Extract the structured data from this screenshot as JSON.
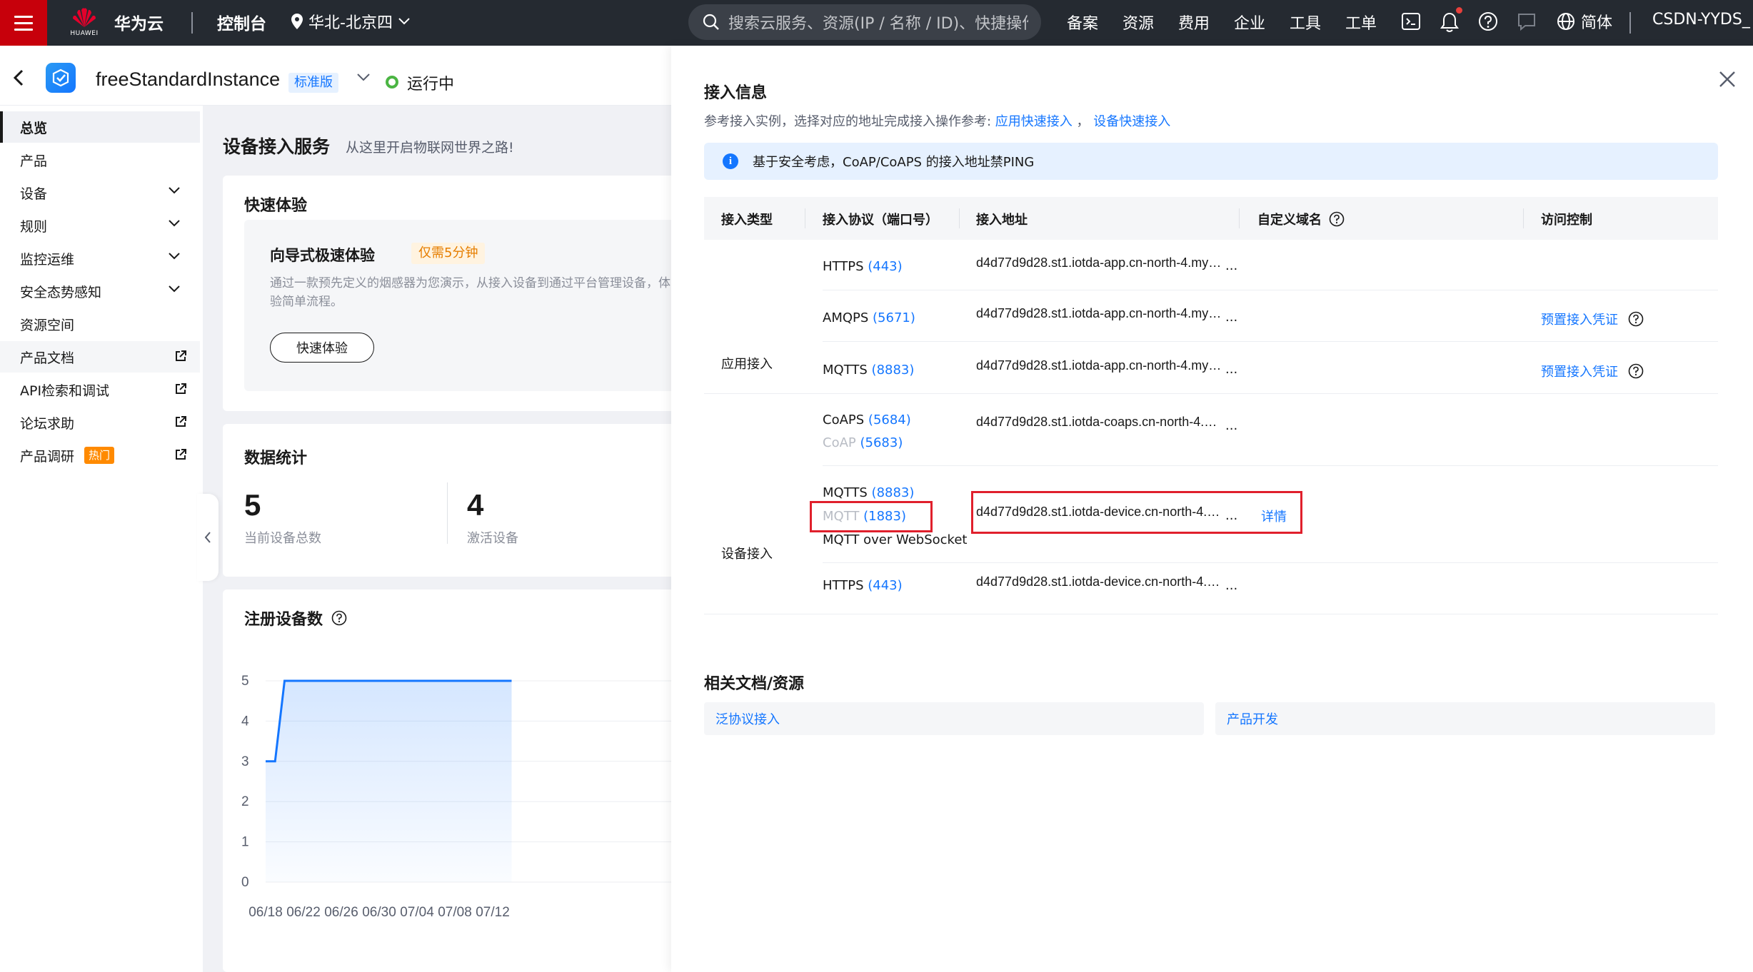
{
  "topnav": {
    "brand_word": "HUAWEI",
    "brand_name": "华为云",
    "console": "控制台",
    "region": "华北-北京四",
    "search_placeholder": "搜索云服务、资源(IP / 名称 / ID)、快捷操作…",
    "links": [
      "备案",
      "资源",
      "费用",
      "企业",
      "工具",
      "工单"
    ],
    "language": "简体",
    "account": "CSDN-YYDS_"
  },
  "instance": {
    "name": "freeStandardInstance",
    "edition": "标准版",
    "status": "运行中"
  },
  "sidebar": {
    "items": [
      {
        "label": "总览",
        "active": true
      },
      {
        "label": "产品"
      },
      {
        "label": "设备",
        "expandable": true
      },
      {
        "label": "规则",
        "expandable": true
      },
      {
        "label": "监控运维",
        "expandable": true
      },
      {
        "label": "安全态势感知",
        "expandable": true
      },
      {
        "label": "资源空间"
      },
      {
        "label": "产品文档",
        "external": true
      },
      {
        "label": "API检索和调试",
        "external": true
      },
      {
        "label": "论坛求助",
        "external": true
      },
      {
        "label": "产品调研",
        "external": true,
        "badge": "热门"
      }
    ]
  },
  "main": {
    "title": "设备接入服务",
    "subtitle": "从这里开启物联网世界之路!",
    "quick": {
      "title": "快速体验",
      "heading": "向导式极速体验",
      "badge": "仅需5分钟",
      "desc": "通过一款预先定义的烟感器为您演示，从接入设备到通过平台管理设备，体验简单流程。",
      "button": "快速体验"
    },
    "stats": {
      "title": "数据统计",
      "total_devices": "5",
      "total_label": "当前设备总数",
      "active_devices": "4",
      "active_label": "激活设备"
    },
    "chart_title": "注册设备数"
  },
  "chart_data": {
    "type": "area",
    "title": "注册设备数",
    "x": [
      "06/18",
      "06/22",
      "06/26",
      "06/30",
      "07/04",
      "07/08",
      "07/12"
    ],
    "points": [
      {
        "x": "06/18",
        "y": 3
      },
      {
        "x": "06/19",
        "y": 3
      },
      {
        "x": "06/20",
        "y": 5
      },
      {
        "x": "07/14",
        "y": 5
      }
    ],
    "yticks": [
      0,
      1,
      2,
      3,
      4,
      5
    ],
    "ylim": [
      0,
      5
    ],
    "color": "#1476ff"
  },
  "drawer": {
    "title": "接入信息",
    "desc_prefix": "参考接入实例，选择对应的地址完成接入操作参考:",
    "desc_link1": "应用快速接入",
    "desc_sep": "，",
    "desc_link2": "设备快速接入",
    "alert": "基于安全考虑，CoAP/CoAPS 的接入地址禁PING",
    "columns": [
      "接入类型",
      "接入协议（端口号）",
      "接入地址",
      "自定义域名",
      "访问控制"
    ],
    "groups": [
      {
        "type": "应用接入"
      },
      {
        "type": "设备接入"
      }
    ],
    "rows": [
      {
        "protocols": [
          {
            "name": "HTTPS",
            "port": "(443)"
          }
        ],
        "address": "d4d77d9d28.st1.iotda-app.cn-north-4.my…",
        "access": ""
      },
      {
        "protocols": [
          {
            "name": "AMQPS",
            "port": "(5671)"
          }
        ],
        "address": "d4d77d9d28.st1.iotda-app.cn-north-4.my…",
        "access": "预置接入凭证"
      },
      {
        "protocols": [
          {
            "name": "MQTTS",
            "port": "(8883)"
          }
        ],
        "address": "d4d77d9d28.st1.iotda-app.cn-north-4.my…",
        "access": "预置接入凭证"
      },
      {
        "protocols": [
          {
            "name": "CoAPS",
            "port": "(5684)"
          },
          {
            "name": "CoAP",
            "port": "(5683)",
            "disabled": true
          }
        ],
        "address": "d4d77d9d28.st1.iotda-coaps.cn-north-4.…",
        "access": ""
      },
      {
        "protocols": [
          {
            "name": "MQTTS",
            "port": "(8883)"
          },
          {
            "name": "MQTT",
            "port": "(1883)",
            "disabled": true
          },
          {
            "name": "MQTT over WebSocket",
            "port": ""
          }
        ],
        "address": "d4d77d9d28.st1.iotda-device.cn-north-4.…",
        "detail": "详情",
        "access": ""
      },
      {
        "protocols": [
          {
            "name": "HTTPS",
            "port": "(443)"
          }
        ],
        "address": "d4d77d9d28.st1.iotda-device.cn-north-4.…",
        "access": ""
      }
    ],
    "ellipsis": "...",
    "docs_title": "相关文档/资源",
    "docs": [
      "泛协议接入",
      "产品开发"
    ]
  }
}
